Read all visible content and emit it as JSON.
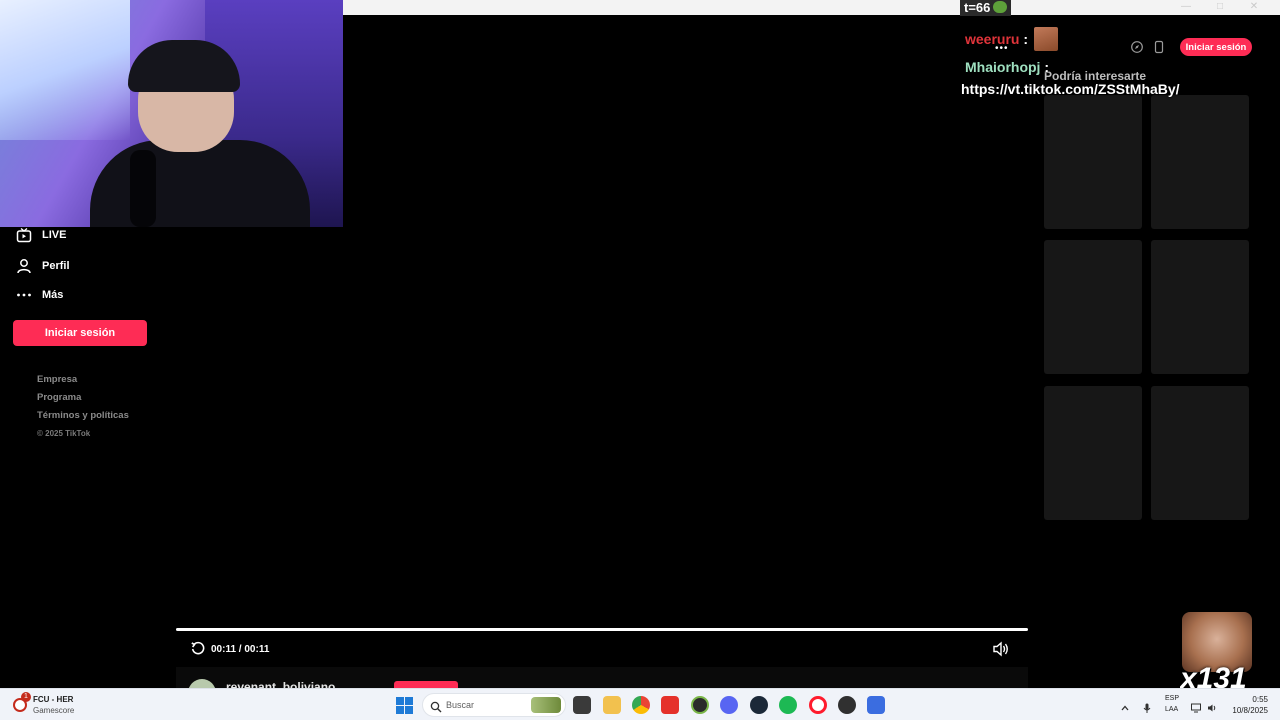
{
  "stream_overlay": {
    "counter_text": "t=66",
    "chat": [
      {
        "user": "weeruru",
        "sep": ":",
        "message": ""
      },
      {
        "user": "Mhaiorhopj",
        "sep": ":",
        "message": "https://vt.tiktok.com/ZSStMhaBy/"
      }
    ],
    "emote_count": "x131"
  },
  "sidebar": {
    "items": [
      {
        "label": "LIVE",
        "icon": "live-tv-icon"
      },
      {
        "label": "Perfil",
        "icon": "profile-icon"
      },
      {
        "label": "Más",
        "icon": "more-dots-icon"
      }
    ],
    "login_label": "Iniciar sesión",
    "footer_links": [
      "Empresa",
      "Programa",
      "Términos y políticas"
    ],
    "copyright": "© 2025 TikTok"
  },
  "player": {
    "time": "00:11 / 00:11",
    "progress": 1.0,
    "author": "revenant_boliviano"
  },
  "header": {
    "login_label": "Iniciar sesión"
  },
  "recommendations": {
    "title": "Podría interesarte",
    "tile_count": 6
  },
  "taskbar": {
    "notification_count": "1",
    "game_title": "FCU - HER",
    "game_subtitle": "Gamescore",
    "search_placeholder": "Buscar",
    "apps": [
      "file-manager-icon",
      "folder-icon",
      "chrome-icon",
      "red-app-icon",
      "xbox-icon",
      "discord-icon",
      "steam-icon",
      "spotify-icon",
      "opera-icon",
      "obs-icon",
      "blue-app-icon"
    ],
    "lang_line1": "ESP",
    "lang_line2": "LAA",
    "time": "0:55",
    "date": "10/8/2025"
  },
  "colors": {
    "accent": "#fe2c55",
    "background": "#000000",
    "tile": "#171717",
    "chat_user1": "#e0343a",
    "chat_user2": "#9fe0c0"
  }
}
